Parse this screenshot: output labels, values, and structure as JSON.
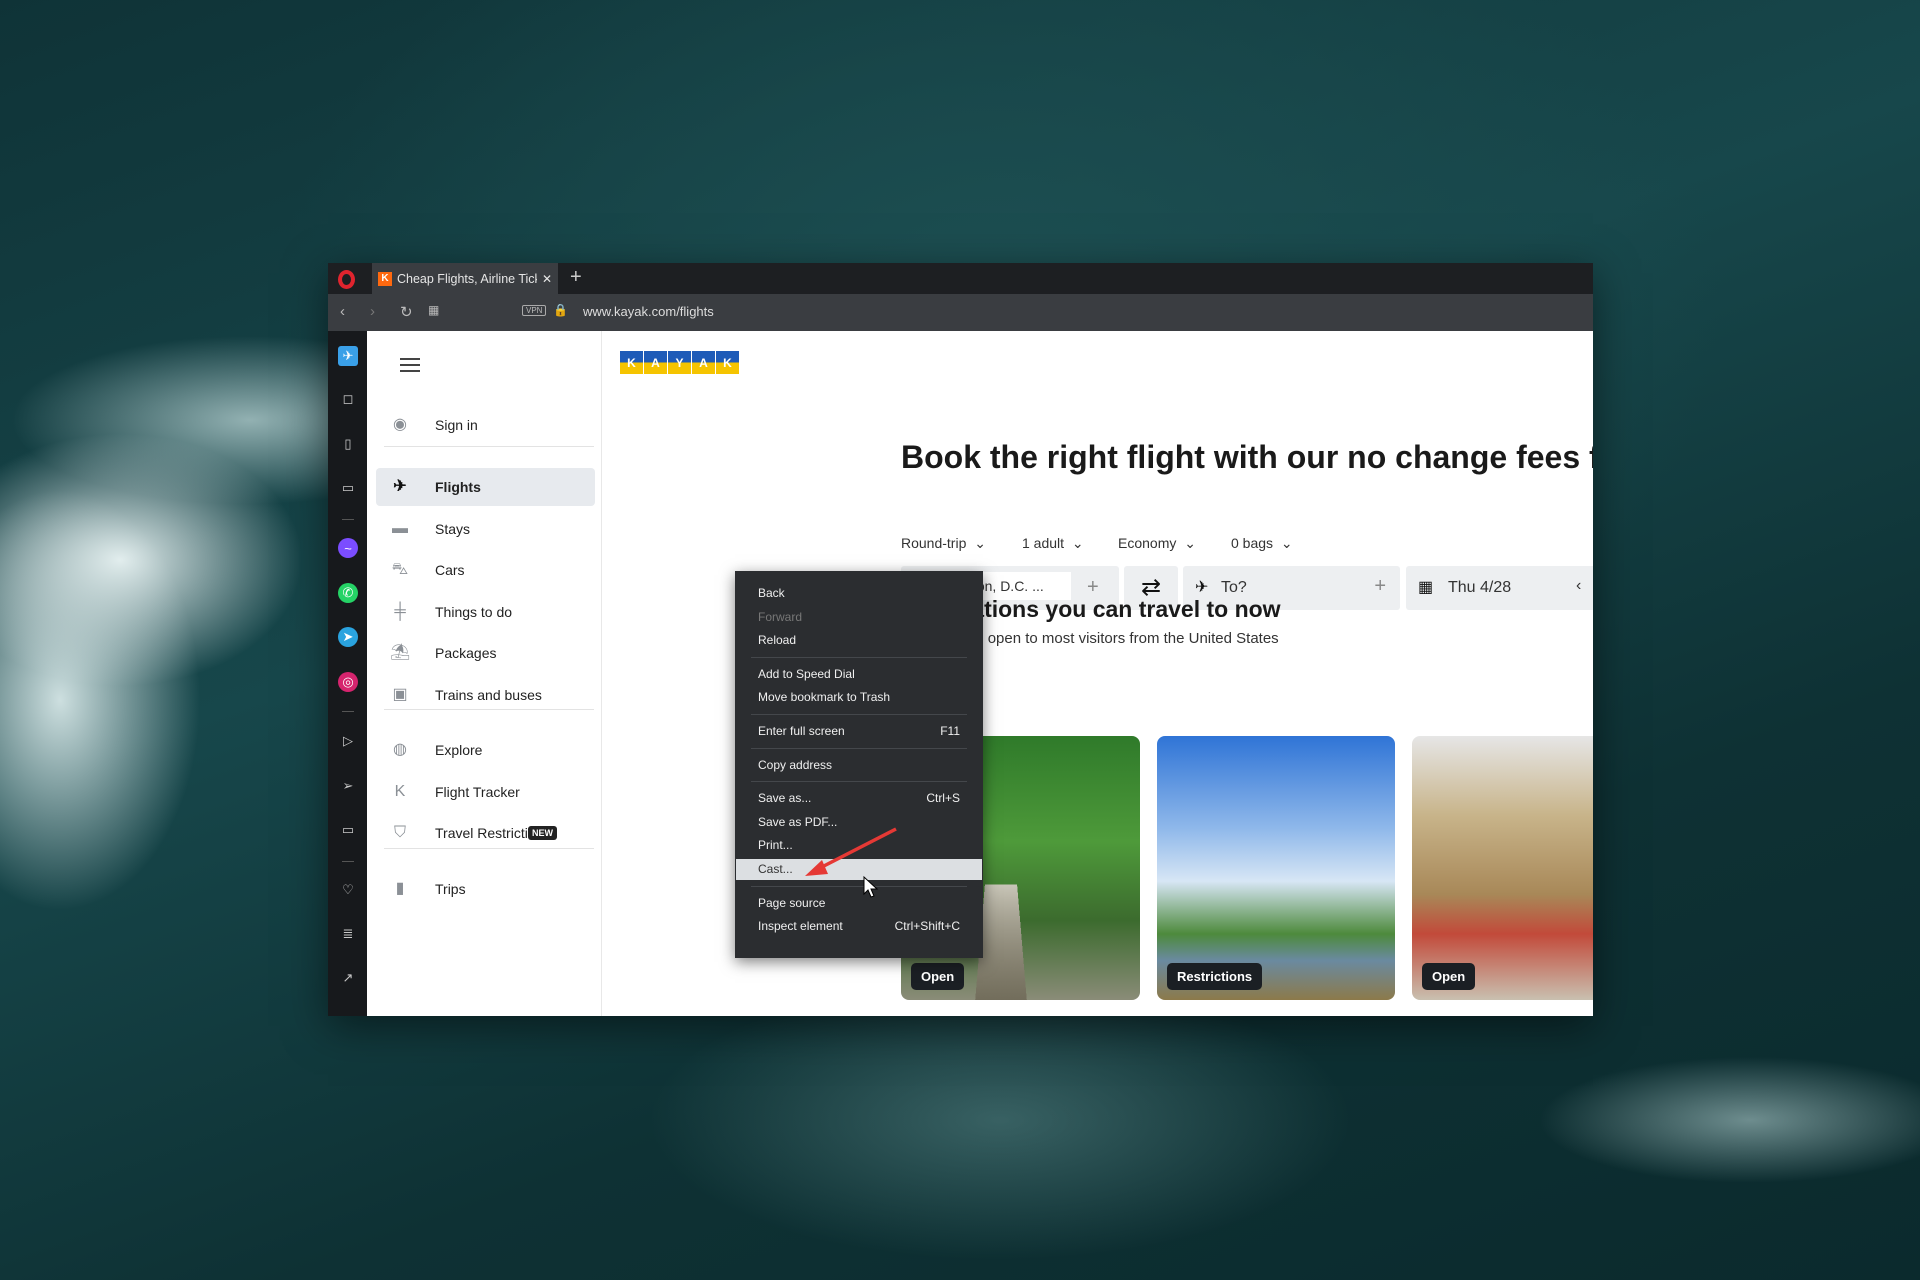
{
  "browser": {
    "tab_title": "Cheap Flights, Airline Tickets",
    "url": "www.kayak.com/flights",
    "vpn_label": "VPN",
    "new_tab": "+",
    "close_tab": "✕"
  },
  "opera_sidebar": {
    "icons": [
      "aria-plane-icon",
      "shopping-bag-icon",
      "book-icon",
      "briefcase-icon",
      "sep",
      "messenger-icon",
      "whatsapp-icon",
      "telegram-icon",
      "instagram-icon",
      "sep",
      "player-icon",
      "send-icon",
      "wallet-icon",
      "sep",
      "heart-icon",
      "news-icon",
      "chart-icon"
    ]
  },
  "kayak": {
    "logo": "KAYAK",
    "sidebar": [
      {
        "label": "Sign in",
        "icon": "user-icon"
      },
      {
        "sep": true
      },
      {
        "label": "Flights",
        "icon": "plane-icon",
        "active": true
      },
      {
        "label": "Stays",
        "icon": "bed-icon"
      },
      {
        "label": "Cars",
        "icon": "car-icon"
      },
      {
        "label": "Things to do",
        "icon": "signpost-icon"
      },
      {
        "label": "Packages",
        "icon": "umbrella-icon"
      },
      {
        "label": "Trains and buses",
        "icon": "train-icon"
      },
      {
        "sep": true
      },
      {
        "label": "Explore",
        "icon": "globe-icon"
      },
      {
        "label": "Flight Tracker",
        "icon": "kayak-k-icon"
      },
      {
        "label": "Travel Restrictions",
        "icon": "shield-icon",
        "badge": "NEW"
      },
      {
        "sep": true
      },
      {
        "label": "Trips",
        "icon": "trips-icon"
      }
    ],
    "headline": "Book the right flight with our no change fees f",
    "options": [
      "Round-trip",
      "1 adult",
      "Economy",
      "0 bags"
    ],
    "search": {
      "origin": "Washington, D.C. ...",
      "destination_placeholder": "To?",
      "date": "Thu 4/28"
    },
    "section_title": "Destinations you can travel to now",
    "section_subtitle": "Destinations open to most visitors from the United States",
    "cards": [
      {
        "badge": "Open"
      },
      {
        "badge": "Restrictions"
      },
      {
        "badge": "Open"
      }
    ]
  },
  "context_menu": [
    {
      "label": "Back"
    },
    {
      "label": "Forward",
      "disabled": true
    },
    {
      "label": "Reload"
    },
    {
      "sep": true
    },
    {
      "label": "Add to Speed Dial"
    },
    {
      "label": "Move bookmark to Trash"
    },
    {
      "sep": true
    },
    {
      "label": "Enter full screen",
      "shortcut": "F11"
    },
    {
      "sep": true
    },
    {
      "label": "Copy address"
    },
    {
      "sep": true
    },
    {
      "label": "Save as...",
      "shortcut": "Ctrl+S"
    },
    {
      "label": "Save as PDF..."
    },
    {
      "label": "Print..."
    },
    {
      "label": "Cast...",
      "highlighted": true
    },
    {
      "sep": true
    },
    {
      "label": "Page source"
    },
    {
      "label": "Inspect element",
      "shortcut": "Ctrl+Shift+C"
    }
  ],
  "colors": {
    "accent": "#ff690f",
    "arrow": "#e53935"
  }
}
